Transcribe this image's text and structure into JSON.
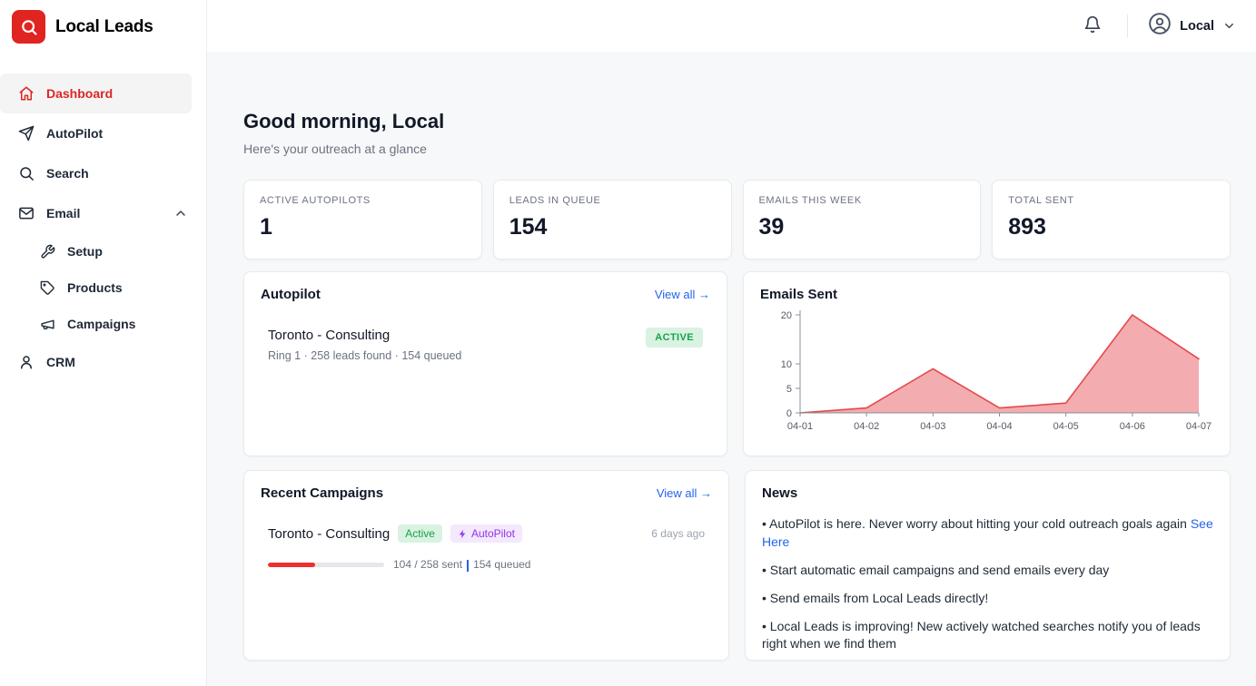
{
  "app": {
    "name": "Local Leads"
  },
  "topbar": {
    "user_label": "Local"
  },
  "sidebar": {
    "items": [
      {
        "label": "Dashboard",
        "icon": "home",
        "active": true
      },
      {
        "label": "AutoPilot",
        "icon": "paper-plane"
      },
      {
        "label": "Search",
        "icon": "search"
      },
      {
        "label": "Email",
        "icon": "mail",
        "expanded": true
      },
      {
        "label": "Setup",
        "icon": "tools",
        "sub": true
      },
      {
        "label": "Products",
        "icon": "tag",
        "sub": true
      },
      {
        "label": "Campaigns",
        "icon": "megaphone",
        "sub": true
      },
      {
        "label": "CRM",
        "icon": "user"
      }
    ]
  },
  "greeting": {
    "title": "Good morning, Local",
    "subtitle": "Here's your outreach at a glance"
  },
  "stats": [
    {
      "label": "ACTIVE AUTOPILOTS",
      "value": "1"
    },
    {
      "label": "LEADS IN QUEUE",
      "value": "154"
    },
    {
      "label": "EMAILS THIS WEEK",
      "value": "39"
    },
    {
      "label": "TOTAL SENT",
      "value": "893"
    }
  ],
  "autopilot_card": {
    "title": "Autopilot",
    "view_all": "View all →",
    "item": {
      "name": "Toronto - Consulting",
      "meta": "Ring 1 · 258 leads found · 154 queued",
      "status": "ACTIVE"
    }
  },
  "emails_card": {
    "title": "Emails Sent"
  },
  "chart_data": {
    "type": "area",
    "title": "Emails Sent",
    "x": [
      "04-01",
      "04-02",
      "04-03",
      "04-04",
      "04-05",
      "04-06",
      "04-07"
    ],
    "values": [
      0,
      1,
      9,
      1,
      2,
      20,
      11
    ],
    "xlabel": "",
    "ylabel": "",
    "ylim": [
      0,
      20
    ],
    "yticks": [
      0,
      5,
      10,
      20
    ],
    "grid": false,
    "legend": false,
    "line_color": "#e5484d",
    "fill_color": "rgba(229,72,77,0.45)"
  },
  "campaigns_card": {
    "title": "Recent Campaigns",
    "view_all": "View all →",
    "item": {
      "name": "Toronto - Consulting",
      "status_badge": "Active",
      "autopilot_badge": "AutoPilot",
      "time_ago": "6 days ago",
      "progress_percent": 40.3,
      "sent_text": "104 / 258 sent",
      "queued_text": "154 queued"
    }
  },
  "news_card": {
    "title": "News",
    "items": [
      {
        "text": "• AutoPilot is here. Never worry about hitting your cold outreach goals again",
        "link_text": "See Here"
      },
      {
        "text": "• Start automatic email campaigns and send emails every day"
      },
      {
        "text": "• Send emails from Local Leads directly!"
      },
      {
        "text": "• Local Leads is improving! New actively watched searches notify you of leads right when we find them"
      }
    ]
  },
  "colors": {
    "accent_red": "#dc2626",
    "link_blue": "#2563eb",
    "badge_green_bg": "#d9f2e1",
    "badge_green_text": "#16a34a",
    "badge_purple_bg": "#f3e8fd",
    "badge_purple_text": "#9333ea"
  }
}
